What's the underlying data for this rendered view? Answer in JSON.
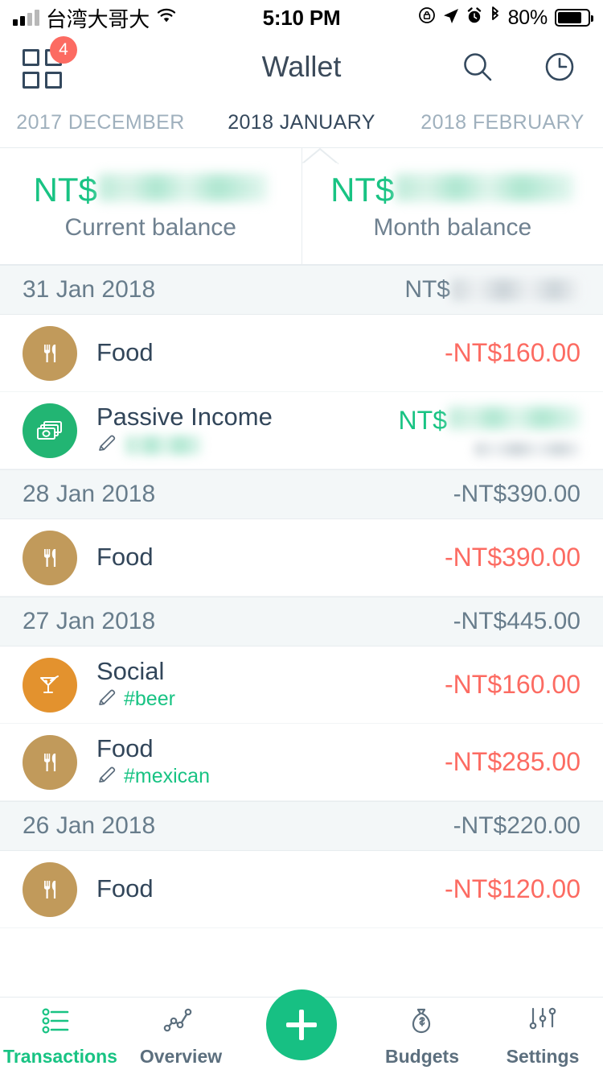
{
  "status_bar": {
    "carrier": "台湾大哥大",
    "time": "5:10 PM",
    "battery_percent": "80%",
    "icons": [
      "signal-bars-icon",
      "wifi-icon",
      "rotation-lock-icon",
      "location-arrow-icon",
      "alarm-icon",
      "bluetooth-icon",
      "battery-icon"
    ]
  },
  "nav": {
    "title": "Wallet",
    "grid_badge": "4",
    "search_icon": "search-icon",
    "history_icon": "clock-history-icon"
  },
  "months": {
    "items": [
      {
        "label": "2017 DECEMBER",
        "active": false
      },
      {
        "label": "2018 JANUARY",
        "active": true
      },
      {
        "label": "2018 FEBRUARY",
        "active": false
      }
    ]
  },
  "balances": [
    {
      "currency": "NT$",
      "value": "",
      "hidden": true,
      "label": "Current balance"
    },
    {
      "currency": "NT$",
      "value": "",
      "hidden": true,
      "label": "Month balance"
    }
  ],
  "colors": {
    "income_green": "#18c383",
    "expense_red": "#fc6b62",
    "text_dark": "#32465a",
    "text_muted": "#687d8c",
    "badge_red": "#fc6b62",
    "fab_green": "#17c083",
    "food_icon_bg": "#c19a5b",
    "social_icon_bg": "#e3922e",
    "income_icon_bg": "#22b573",
    "row_header_bg": "#f3f7f8"
  },
  "groups": [
    {
      "date": "31 Jan 2018",
      "total": "NT$",
      "total_hidden": true,
      "total_sign": "positive",
      "transactions": [
        {
          "category": "Food",
          "icon": "cutlery-icon",
          "icon_bg": "#c19a5b",
          "note": "",
          "note_hidden": false,
          "has_note": false,
          "amount": "-NT$160.00",
          "amount_type": "expense",
          "amount_hidden": false
        },
        {
          "category": "Passive Income",
          "icon": "banknotes-icon",
          "icon_bg": "#22b573",
          "note": "",
          "note_hidden": true,
          "has_note": true,
          "amount": "NT$",
          "amount_type": "income",
          "amount_hidden": true,
          "amount_sub_hidden": true
        }
      ]
    },
    {
      "date": "28 Jan 2018",
      "total": "-NT$390.00",
      "total_hidden": false,
      "total_sign": "negative",
      "transactions": [
        {
          "category": "Food",
          "icon": "cutlery-icon",
          "icon_bg": "#c19a5b",
          "note": "",
          "note_hidden": false,
          "has_note": false,
          "amount": "-NT$390.00",
          "amount_type": "expense",
          "amount_hidden": false
        }
      ]
    },
    {
      "date": "27 Jan 2018",
      "total": "-NT$445.00",
      "total_hidden": false,
      "total_sign": "negative",
      "transactions": [
        {
          "category": "Social",
          "icon": "cocktail-icon",
          "icon_bg": "#e3922e",
          "note": "#beer",
          "note_hidden": false,
          "has_note": true,
          "amount": "-NT$160.00",
          "amount_type": "expense",
          "amount_hidden": false
        },
        {
          "category": "Food",
          "icon": "cutlery-icon",
          "icon_bg": "#c19a5b",
          "note": "#mexican",
          "note_hidden": false,
          "has_note": true,
          "amount": "-NT$285.00",
          "amount_type": "expense",
          "amount_hidden": false
        }
      ]
    },
    {
      "date": "26 Jan 2018",
      "total": "-NT$220.00",
      "total_hidden": false,
      "total_sign": "negative",
      "transactions": [
        {
          "category": "Food",
          "icon": "cutlery-icon",
          "icon_bg": "#c19a5b",
          "note": "",
          "note_hidden": false,
          "has_note": false,
          "amount": "-NT$120.00",
          "amount_type": "expense",
          "amount_hidden": false
        }
      ]
    }
  ],
  "tabbar": {
    "items": [
      {
        "label": "Transactions",
        "icon": "list-icon",
        "active": true
      },
      {
        "label": "Overview",
        "icon": "line-chart-icon",
        "active": false
      },
      {
        "label": "Budgets",
        "icon": "money-bag-icon",
        "active": false
      },
      {
        "label": "Settings",
        "icon": "sliders-icon",
        "active": false
      }
    ],
    "add_button": "add-transaction-fab"
  }
}
